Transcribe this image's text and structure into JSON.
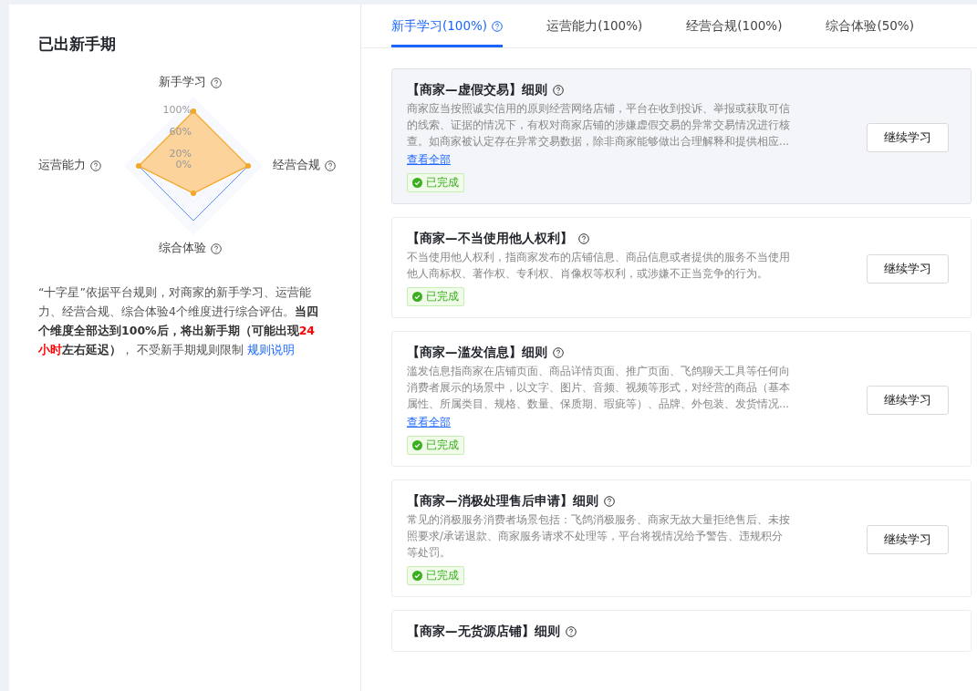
{
  "left_panel": {
    "title": "已出新手期",
    "radar": {
      "ticks": [
        "100%",
        "60%",
        "20%",
        "0%"
      ],
      "axes": [
        {
          "label": "新手学习",
          "level": 1
        },
        {
          "label": "经营合规",
          "level": 1
        },
        {
          "label": "综合体验",
          "level": 0.5
        },
        {
          "label": "运营能力",
          "level": 1
        }
      ]
    },
    "description": [
      {
        "kind": "plain",
        "text": "“十字星”依据平台规则，对商家的新手学习、运营能力、经营合规、综合体验4个维度进行综合评估。"
      },
      {
        "kind": "bold",
        "text": "当四个维度全部达到100%后，将出新手期（可能出现"
      },
      {
        "kind": "alert",
        "text": "24小时"
      },
      {
        "kind": "bold",
        "text": "左右延迟）"
      },
      {
        "kind": "plain",
        "text": "，  不受新手期规则限制 "
      },
      {
        "kind": "link",
        "text": "规则说明"
      }
    ]
  },
  "tabs": [
    {
      "label": "新手学习(100%)",
      "selected": true,
      "help": true
    },
    {
      "label": "运营能力(100%)",
      "selected": false,
      "help": false
    },
    {
      "label": "经营合规(100%)",
      "selected": false,
      "help": false
    },
    {
      "label": "综合体验(50%)",
      "selected": false,
      "help": false
    }
  ],
  "cards": [
    {
      "title": "【商家—虚假交易】细则",
      "highlighted": true,
      "lines": [
        "商家应当按照诚实信用的原则经营网络店铺，平台在收到投诉、举报或获取可信",
        "的线索、证据的情况下，有权对商家店铺的涉嫌虚假交易的异常交易情况进行核",
        "查。如商家被认定存在异常交易数据，除非商家能够做出合理解释和提供相应..."
      ],
      "more": "查看全部",
      "status": "已完成",
      "button": "继续学习"
    },
    {
      "title": "【商家—不当使用他人权利】",
      "highlighted": false,
      "lines": [
        "不当使用他人权利，指商家发布的店铺信息、商品信息或者提供的服务不当使用",
        "他人商标权、著作权、专利权、肖像权等权利，或涉嫌不正当竞争的行为。"
      ],
      "status": "已完成",
      "button": "继续学习"
    },
    {
      "title": "【商家—滥发信息】细则",
      "highlighted": false,
      "lines": [
        "滥发信息指商家在店铺页面、商品详情页面、推广页面、飞鸽聊天工具等任何向",
        "消费者展示的场景中，以文字、图片、音频、视频等形式，对经营的商品（基本",
        "属性、所属类目、规格、数量、保质期、瑕疵等）、品牌、外包装、发货情况..."
      ],
      "more": "查看全部",
      "status": "已完成",
      "button": "继续学习"
    },
    {
      "title": "【商家—消极处理售后申请】细则",
      "highlighted": false,
      "lines": [
        "常见的消极服务消费者场景包括：飞鸽消极服务、商家无故大量拒绝售后、未按",
        "照要求/承诺退款、商家服务请求不处理等，平台将视情况给予警告、违规积分",
        "等处罚。"
      ],
      "status": "已完成",
      "button": "继续学习"
    },
    {
      "title": "【商家—无货源店铺】细则",
      "highlighted": false
    }
  ]
}
